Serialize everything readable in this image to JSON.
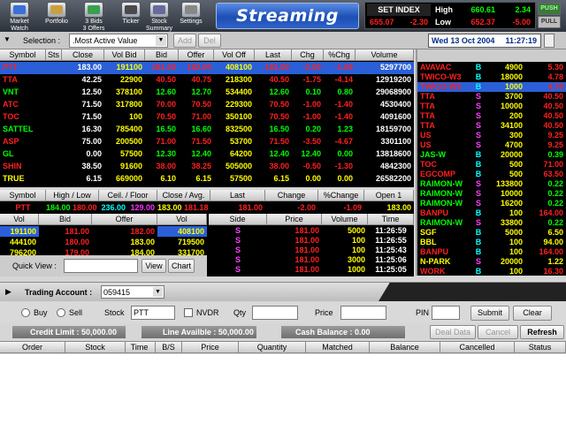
{
  "toolbar": {
    "items": [
      {
        "label1": "Market",
        "label2": "Watch",
        "icon": "market-watch-icon",
        "color": "#3a6fd8"
      },
      {
        "label1": "Portfolio",
        "label2": "",
        "icon": "portfolio-icon",
        "color": "#c8a040"
      },
      {
        "label1": "3 Bids",
        "label2": "3 Offers",
        "icon": "bids-offers-icon",
        "color": "#3aa04a"
      },
      {
        "label1": "Ticker",
        "label2": "",
        "icon": "ticker-icon",
        "color": "#4a4a4a"
      },
      {
        "label1": "Stock",
        "label2": "Summary",
        "icon": "stock-summary-icon",
        "color": "#6a6a9a"
      },
      {
        "label1": "Settings",
        "label2": "",
        "icon": "settings-icon",
        "color": "#888"
      }
    ],
    "logo": "Streaming"
  },
  "index": {
    "name": "SET INDEX",
    "value": "655.07",
    "change": "-2.30",
    "high_label": "High",
    "high_value": "660.61",
    "high_change": "2.34",
    "low_label": "Low",
    "low_value": "652.37",
    "low_change": "-5.00",
    "push": "PUSH",
    "pull": "PULL"
  },
  "selection": {
    "label": "Selection :",
    "value": ".Most Active Value",
    "add": "Add",
    "del": "Del",
    "date": "Wed 13 Oct 2004",
    "time": "11:27:19"
  },
  "main_table": {
    "headers": [
      "Symbol",
      "Sts",
      "Close",
      "Vol Bid",
      "Bid",
      "Offer",
      "Vol Off",
      "Last",
      "Chg",
      "%Chg",
      "Volume"
    ],
    "rows": [
      {
        "symbol": "PTT",
        "sts": "",
        "close": "183.00",
        "volbid": "191100",
        "bid": "181.00",
        "offer": "182.00",
        "voloff": "408100",
        "last": "181.00",
        "chg": "-2.00",
        "pchg": "-1.09",
        "volume": "5297700",
        "sym_c": "r",
        "val_c": "r"
      },
      {
        "symbol": "TTA",
        "sts": "",
        "close": "42.25",
        "volbid": "22900",
        "bid": "40.50",
        "offer": "40.75",
        "voloff": "218300",
        "last": "40.50",
        "chg": "-1.75",
        "pchg": "-4.14",
        "volume": "12919200",
        "sym_c": "r",
        "val_c": "r"
      },
      {
        "symbol": "VNT",
        "sts": "",
        "close": "12.50",
        "volbid": "378100",
        "bid": "12.60",
        "offer": "12.70",
        "voloff": "534400",
        "last": "12.60",
        "chg": "0.10",
        "pchg": "0.80",
        "volume": "29068900",
        "sym_c": "g",
        "val_c": "g"
      },
      {
        "symbol": "ATC",
        "sts": "",
        "close": "71.50",
        "volbid": "317800",
        "bid": "70.00",
        "offer": "70.50",
        "voloff": "229300",
        "last": "70.50",
        "chg": "-1.00",
        "pchg": "-1.40",
        "volume": "4530400",
        "sym_c": "r",
        "val_c": "r"
      },
      {
        "symbol": "TOC",
        "sts": "",
        "close": "71.50",
        "volbid": "100",
        "bid": "70.50",
        "offer": "71.00",
        "voloff": "350100",
        "last": "70.50",
        "chg": "-1.00",
        "pchg": "-1.40",
        "volume": "4091600",
        "sym_c": "r",
        "val_c": "r"
      },
      {
        "symbol": "SATTEL",
        "sts": "",
        "close": "16.30",
        "volbid": "785400",
        "bid": "16.50",
        "offer": "16.60",
        "voloff": "832500",
        "last": "16.50",
        "chg": "0.20",
        "pchg": "1.23",
        "volume": "18159700",
        "sym_c": "g",
        "val_c": "g"
      },
      {
        "symbol": "ASP",
        "sts": "",
        "close": "75.00",
        "volbid": "200500",
        "bid": "71.00",
        "offer": "71.50",
        "voloff": "53700",
        "last": "71.50",
        "chg": "-3.50",
        "pchg": "-4.67",
        "volume": "3301100",
        "sym_c": "r",
        "val_c": "r"
      },
      {
        "symbol": "GL",
        "sts": "",
        "close": "0.00",
        "volbid": "57500",
        "bid": "12.30",
        "offer": "12.40",
        "voloff": "64200",
        "last": "12.40",
        "chg": "12.40",
        "pchg": "0.00",
        "volume": "13818600",
        "sym_c": "g",
        "val_c": "g"
      },
      {
        "symbol": "SHIN",
        "sts": "",
        "close": "38.50",
        "volbid": "91600",
        "bid": "38.00",
        "offer": "38.25",
        "voloff": "505000",
        "last": "38.00",
        "chg": "-0.50",
        "pchg": "-1.30",
        "volume": "4842300",
        "sym_c": "r",
        "val_c": "r"
      },
      {
        "symbol": "TRUE",
        "sts": "",
        "close": "6.15",
        "volbid": "669000",
        "bid": "6.10",
        "offer": "6.15",
        "voloff": "57500",
        "last": "6.15",
        "chg": "0.00",
        "pchg": "0.00",
        "volume": "26582200",
        "sym_c": "y",
        "val_c": "y"
      }
    ]
  },
  "ticker": {
    "rows": [
      {
        "symbol": "AVAVAC",
        "side": "B",
        "vol": "4900",
        "price": "5.30",
        "c": "r"
      },
      {
        "symbol": "TWICO-W3",
        "side": "B",
        "vol": "18000",
        "price": "4.78",
        "c": "r"
      },
      {
        "symbol": "TWICO-W3",
        "side": "B",
        "vol": "1000",
        "price": "4.78",
        "c": "r"
      },
      {
        "symbol": "TTA",
        "side": "S",
        "vol": "3700",
        "price": "40.50",
        "c": "r"
      },
      {
        "symbol": "TTA",
        "side": "S",
        "vol": "10000",
        "price": "40.50",
        "c": "r"
      },
      {
        "symbol": "TTA",
        "side": "S",
        "vol": "200",
        "price": "40.50",
        "c": "r"
      },
      {
        "symbol": "TTA",
        "side": "S",
        "vol": "34100",
        "price": "40.50",
        "c": "r"
      },
      {
        "symbol": "US",
        "side": "S",
        "vol": "300",
        "price": "9.25",
        "c": "r"
      },
      {
        "symbol": "US",
        "side": "S",
        "vol": "4700",
        "price": "9.25",
        "c": "r"
      },
      {
        "symbol": "JAS-W",
        "side": "B",
        "vol": "20000",
        "price": "0.39",
        "c": "g"
      },
      {
        "symbol": "TOC",
        "side": "B",
        "vol": "500",
        "price": "71.00",
        "c": "r"
      },
      {
        "symbol": "EGCOMP",
        "side": "B",
        "vol": "500",
        "price": "63.50",
        "c": "r"
      },
      {
        "symbol": "RAIMON-W",
        "side": "S",
        "vol": "133800",
        "price": "0.22",
        "c": "g"
      },
      {
        "symbol": "RAIMON-W",
        "side": "S",
        "vol": "10000",
        "price": "0.22",
        "c": "g"
      },
      {
        "symbol": "RAIMON-W",
        "side": "S",
        "vol": "16200",
        "price": "0.22",
        "c": "g"
      },
      {
        "symbol": "BANPU",
        "side": "B",
        "vol": "100",
        "price": "164.00",
        "c": "r"
      },
      {
        "symbol": "RAIMON-W",
        "side": "S",
        "vol": "33800",
        "price": "0.22",
        "c": "g"
      },
      {
        "symbol": "SGF",
        "side": "B",
        "vol": "5000",
        "price": "6.50",
        "c": "y"
      },
      {
        "symbol": "BBL",
        "side": "B",
        "vol": "100",
        "price": "94.00",
        "c": "y"
      },
      {
        "symbol": "BANPU",
        "side": "B",
        "vol": "100",
        "price": "164.00",
        "c": "r"
      },
      {
        "symbol": "N-PARK",
        "side": "S",
        "vol": "20000",
        "price": "1.22",
        "c": "y"
      },
      {
        "symbol": "WORK",
        "side": "B",
        "vol": "100",
        "price": "16.30",
        "c": "r"
      }
    ]
  },
  "quote": {
    "headers": [
      "Symbol",
      "High / Low",
      "Ceil. / Floor",
      "Close / Avg.",
      "Last",
      "Change",
      "%Change",
      "Open 1"
    ],
    "symbol": "PTT",
    "high": "184.00",
    "low": "180.00",
    "ceil": "236.00",
    "floor": "129.00",
    "close": "183.00",
    "avg": "181.18",
    "last": "181.00",
    "change": "-2.00",
    "pchg": "-1.09",
    "open1": "183.00",
    "bo_headers": [
      "Vol",
      "Bid",
      "Offer",
      "Vol"
    ],
    "bo_rows": [
      {
        "vb": "191100",
        "bid": "181.00",
        "offer": "182.00",
        "vo": "408100"
      },
      {
        "vb": "444100",
        "bid": "180.00",
        "offer": "183.00",
        "vo": "719500"
      },
      {
        "vb": "796200",
        "bid": "179.00",
        "offer": "184.00",
        "vo": "331700"
      }
    ],
    "tk_headers": [
      "Side",
      "Price",
      "Volume",
      "Time"
    ],
    "tk_rows": [
      {
        "side": "S",
        "price": "181.00",
        "vol": "5000",
        "time": "11:26:59"
      },
      {
        "side": "S",
        "price": "181.00",
        "vol": "100",
        "time": "11:26:55"
      },
      {
        "side": "S",
        "price": "181.00",
        "vol": "100",
        "time": "11:25:43"
      },
      {
        "side": "S",
        "price": "181.00",
        "vol": "3000",
        "time": "11:25:06"
      },
      {
        "side": "S",
        "price": "181.00",
        "vol": "1000",
        "time": "11:25:05"
      }
    ]
  },
  "quick": {
    "label": "Quick View :",
    "view": "View",
    "chart": "Chart"
  },
  "trading": {
    "account_label": "Trading Account :",
    "account": "059415",
    "buy": "Buy",
    "sell": "Sell",
    "stock_label": "Stock",
    "stock": "PTT",
    "nvdr": "NVDR",
    "qty": "Qty",
    "price": "Price",
    "pin": "PIN",
    "submit": "Submit",
    "clear": "Clear",
    "credit": "Credit Limit : 50,000.00",
    "line": "Line Availble : 50,000.00",
    "cash": "Cash Balance : 0.00",
    "deal": "Deal Data",
    "cancel": "Cancel",
    "refresh": "Refresh",
    "headers": [
      "Order",
      "Stock",
      "Time",
      "B/S",
      "Price",
      "Quantity",
      "Matched",
      "Balance",
      "Cancelled",
      "Status"
    ]
  },
  "colors": {
    "up": "#00ff00",
    "down": "#ff2020",
    "unch": "#ffff00",
    "accent": "#1c4fb4"
  }
}
